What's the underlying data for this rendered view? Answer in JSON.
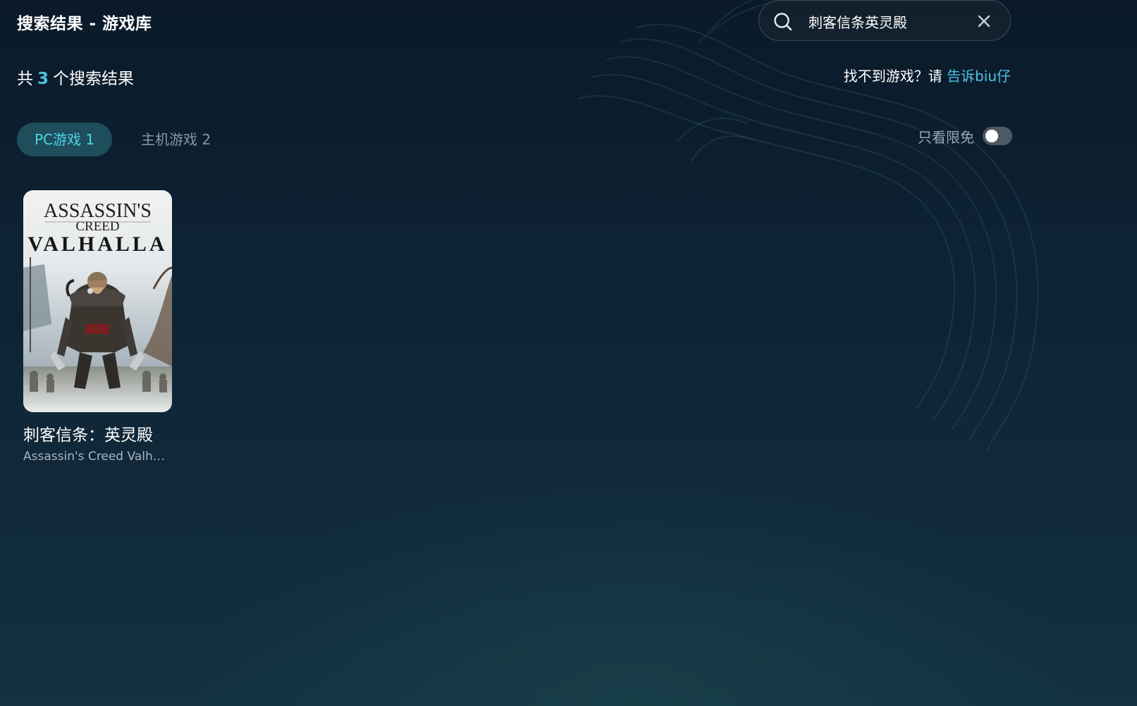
{
  "header": {
    "title": "搜索结果 - 游戏库"
  },
  "search": {
    "value": "刺客信条英灵殿",
    "search_icon": "search-icon",
    "clear_icon": "close-icon"
  },
  "results": {
    "prefix": "共",
    "count": "3",
    "suffix": "个搜索结果"
  },
  "report": {
    "question": "找不到游戏？请",
    "link_label": "告诉biu仔"
  },
  "tabs": [
    {
      "label": "PC游戏 1",
      "active": true
    },
    {
      "label": "主机游戏 2",
      "active": false
    }
  ],
  "filter": {
    "label": "只看限免",
    "enabled": false
  },
  "games": [
    {
      "title_cn": "刺客信条：英灵殿",
      "title_en": "Assassin's Creed Valhalla",
      "cover_text_line1": "ASSASSIN'S",
      "cover_text_line2": "CREED",
      "cover_text_line3": "VALHALLA"
    }
  ],
  "colors": {
    "accent": "#4fc3e6",
    "tab_active_bg": "#1e4d5b",
    "background": "#0d2233"
  }
}
